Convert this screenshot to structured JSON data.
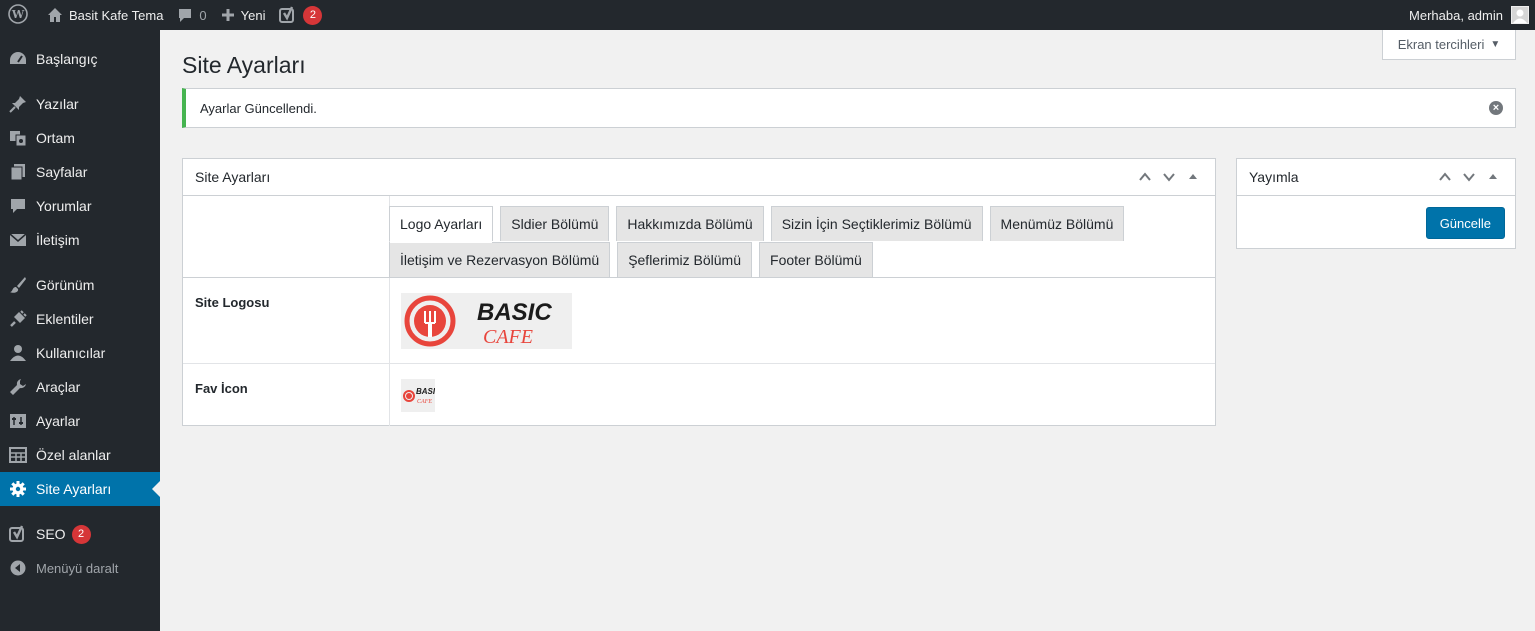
{
  "adminbar": {
    "site_name": "Basit Kafe Tema",
    "comments_count": "0",
    "new_label": "Yeni",
    "seo_badge": "2",
    "greeting": "Merhaba, admin"
  },
  "sidebar": {
    "items": [
      {
        "label": "Başlangıç",
        "icon": "dashboard-icon"
      },
      {
        "label": "Yazılar",
        "icon": "pin-icon"
      },
      {
        "label": "Ortam",
        "icon": "media-icon"
      },
      {
        "label": "Sayfalar",
        "icon": "page-icon"
      },
      {
        "label": "Yorumlar",
        "icon": "comment-icon"
      },
      {
        "label": "İletişim",
        "icon": "mail-icon"
      },
      {
        "label": "Görünüm",
        "icon": "brush-icon"
      },
      {
        "label": "Eklentiler",
        "icon": "plug-icon"
      },
      {
        "label": "Kullanıcılar",
        "icon": "user-icon"
      },
      {
        "label": "Araçlar",
        "icon": "wrench-icon"
      },
      {
        "label": "Ayarlar",
        "icon": "sliders-icon"
      },
      {
        "label": "Özel alanlar",
        "icon": "table-icon"
      },
      {
        "label": "Site Ayarları",
        "icon": "gear-icon"
      },
      {
        "label": "SEO",
        "icon": "yoast-icon",
        "badge": "2"
      }
    ],
    "collapse_label": "Menüyü daralt"
  },
  "screen_options": "Ekran tercihleri",
  "page_title": "Site Ayarları",
  "notice": {
    "message": "Ayarlar Güncellendi."
  },
  "main_box": {
    "title": "Site Ayarları",
    "tabs": [
      "Logo Ayarları",
      "Sldier Bölümü",
      "Hakkımızda Bölümü",
      "Sizin İçin Seçtiklerimiz Bölümü",
      "Menümüz Bölümü",
      "İletişim ve Rezervasyon Bölümü",
      "Şeflerimiz Bölümü",
      "Footer Bölümü"
    ],
    "active_tab": 0,
    "rows": [
      {
        "label": "Site Logosu",
        "logo_text_top": "BASIC",
        "logo_text_bottom": "CAFE"
      },
      {
        "label": "Fav İcon",
        "logo_text_top": "BASIC",
        "logo_text_bottom": "CAFE"
      }
    ]
  },
  "publish_box": {
    "title": "Yayımla",
    "button": "Güncelle"
  },
  "colors": {
    "adminbar_bg": "#23282d",
    "accent": "#0073aa",
    "notice_success": "#46b450",
    "badge": "#d63638",
    "logo_red": "#e8453c"
  }
}
